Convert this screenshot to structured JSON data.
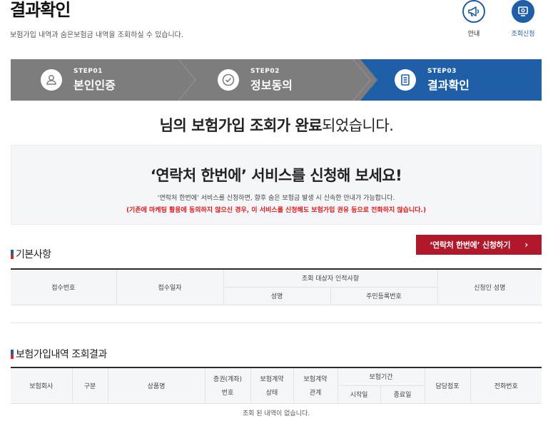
{
  "page": {
    "title": "결과확인",
    "description": "보험가입 내역과 숨은보험금 내역을 조회하실 수 있습니다."
  },
  "top_icons": {
    "guide_label": "안내",
    "apply_label": "조회신청"
  },
  "steps": [
    {
      "num": "STEP01",
      "name": "본인인증"
    },
    {
      "num": "STEP02",
      "name": "정보동의"
    },
    {
      "num": "STEP03",
      "name": "결과확인"
    }
  ],
  "result_message": {
    "prefix": "님의 ",
    "highlight1": "보험가입 조회가 완료",
    "suffix": "되었습니다."
  },
  "promo": {
    "title": "‘연락처 한번에’ 서비스를 신청해 보세요!",
    "desc": "‘연락처 한번에’ 서비스를 신청하면, 향후 숨은 보험금 발생 시 신속한 안내가 가능합니다.",
    "warning": "(기존에 마케팅 활용에 동의하지 않으신 경우, 이 서비스를 신청해도 보험가입 권유 등으로 전화하지 않습니다.)"
  },
  "apply_button": {
    "label": "‘연락처 한번에’ 신청하기",
    "chevron": "›"
  },
  "basic_info": {
    "title": "기본사항",
    "headers": {
      "receipt_no": "접수번호",
      "receipt_date": "접수일자",
      "target_group": "조회 대상자 인적사항",
      "name": "성명",
      "rrn": "주민등록번호",
      "applicant_name": "신청인 성명"
    }
  },
  "insurance_results": {
    "title": "보험가입내역 조회결과",
    "headers": {
      "company": "보험회사",
      "category": "구분",
      "product": "상품명",
      "policy_no_line1": "증권(계좌)",
      "policy_no_line2": "번호",
      "status_line1": "보험계약",
      "status_line2": "상태",
      "relation_line1": "보험계약",
      "relation_line2": "관계",
      "period": "보험기간",
      "start": "시작일",
      "end": "종료일",
      "branch": "담당점포",
      "phone": "전화번호"
    },
    "empty_message": "조회 된 내역이 없습니다."
  }
}
